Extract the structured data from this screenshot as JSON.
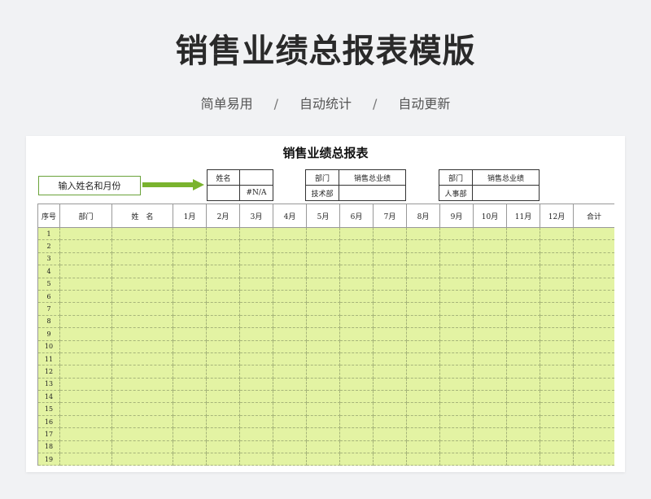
{
  "header": {
    "title": "销售业绩总报表模版",
    "tags": [
      "简单易用",
      "自动统计",
      "自动更新"
    ],
    "separator": "/"
  },
  "sheet": {
    "title": "销售业绩总报表",
    "input_hint": "输入姓名和月份",
    "info_box_1": {
      "r1c1": "姓名",
      "r1c2": "",
      "r2c1": "",
      "r2c2": "#N/A"
    },
    "info_box_2": {
      "r1c1": "部门",
      "r1c2": "销售总业绩",
      "r2c1": "技术部",
      "r2c2": ""
    },
    "info_box_3": {
      "r1c1": "部门",
      "r1c2": "销售总业绩",
      "r2c1": "人事部",
      "r2c2": ""
    },
    "columns": [
      "序号",
      "部门",
      "姓　名",
      "1月",
      "2月",
      "3月",
      "4月",
      "5月",
      "6月",
      "7月",
      "8月",
      "9月",
      "10月",
      "11月",
      "12月",
      "合计"
    ],
    "row_numbers": [
      "1",
      "2",
      "3",
      "4",
      "5",
      "6",
      "7",
      "8",
      "9",
      "10",
      "11",
      "12",
      "13",
      "14",
      "15",
      "16",
      "17",
      "18",
      "19"
    ]
  },
  "colors": {
    "page_bg": "#f1f2f4",
    "row_fill": "#e3f3a3",
    "arrow": "#7ab32e",
    "input_border": "#6aa33a"
  },
  "icons": {
    "arrow": "arrow-right-icon"
  }
}
